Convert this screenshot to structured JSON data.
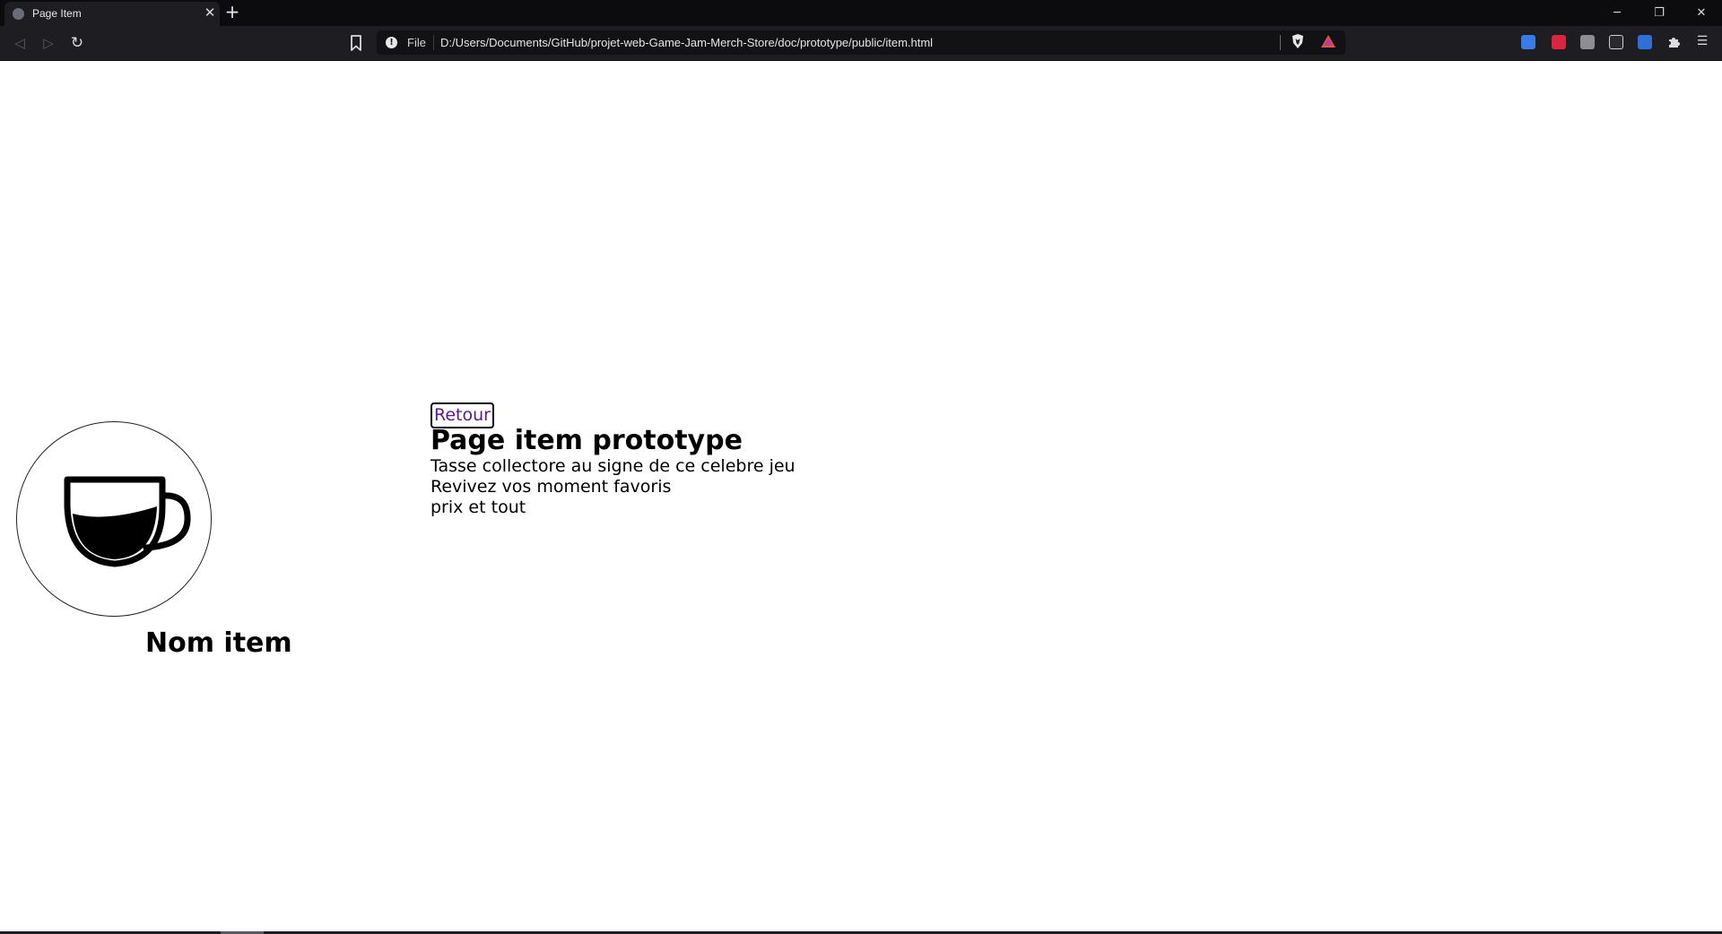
{
  "browser": {
    "tab": {
      "title": "Page Item",
      "close_symbol": "✕"
    },
    "new_tab_symbol": "+",
    "window_controls": {
      "minimize": "─",
      "restore": "❐",
      "close": "✕"
    },
    "nav": {
      "back": "◁",
      "forward": "▷",
      "reload": "↻"
    },
    "address": {
      "scheme": "File",
      "url": "D:/Users/Documents/GitHub/projet-web-Game-Jam-Merch-Store/doc/prototype/public/item.html"
    },
    "menu_symbol": "☰",
    "icons": [
      "tab-favicon-icon",
      "info-icon",
      "bookmark-icon",
      "brave-shield-icon",
      "brave-rewards-icon",
      "translate-icon",
      "extension-red-icon",
      "extension-k-icon",
      "extension-glasses-icon",
      "extension-window-icon",
      "puzzle-icon",
      "menu-icon"
    ]
  },
  "page": {
    "back_label": "Retour",
    "title": "Page item prototype",
    "description": [
      "Tasse collectore au signe de ce celebre jeu",
      "Revivez vos moment favoris",
      "prix et tout"
    ],
    "item_name": "Nom item",
    "image_icon": "coffee-cup-icon"
  },
  "colors": {
    "chrome_dark": "#0c0c0f",
    "toolbar": "#1e1e22",
    "link_visited": "#551a8b",
    "text": "#000000"
  }
}
